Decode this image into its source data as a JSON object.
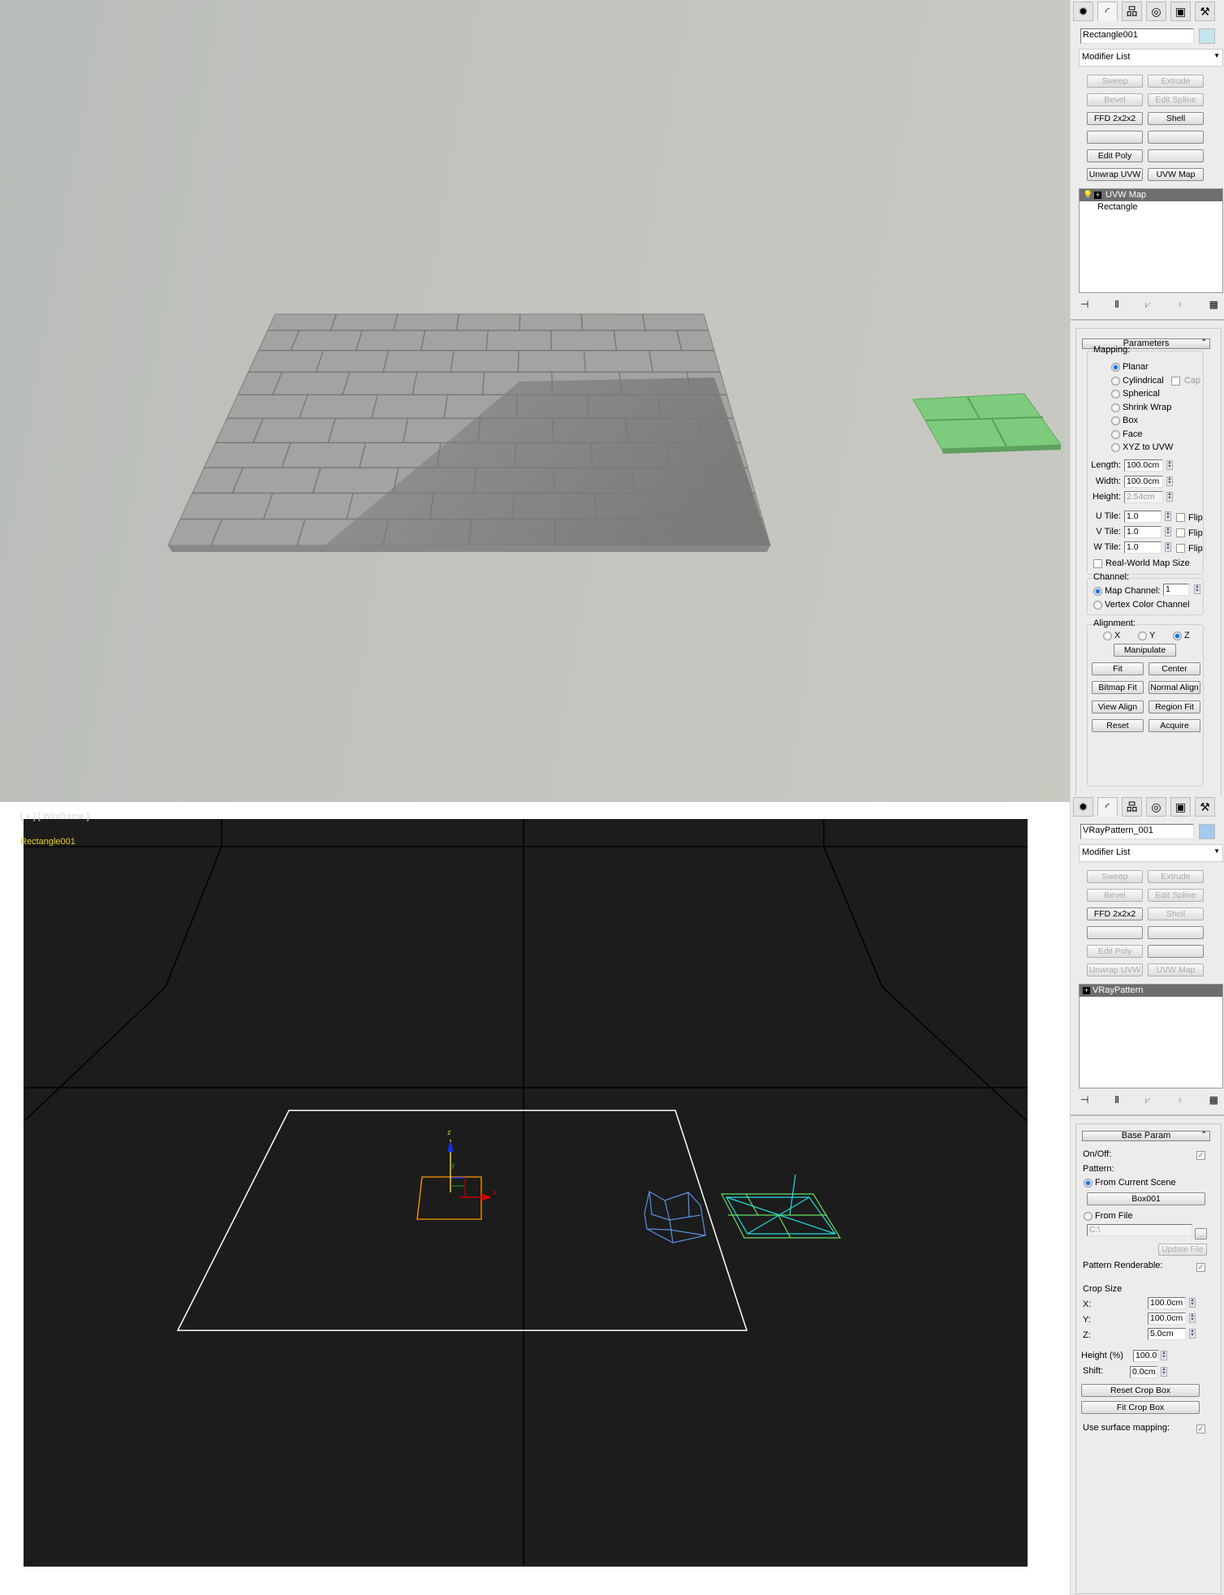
{
  "render_view": {
    "colors": {
      "background": "#c3c4bf",
      "tiles": "#9c9c9a",
      "pattern_tile": "#7ccc7c"
    }
  },
  "viewport": {
    "label": "[ + ] [ Wireframe ]",
    "object_name": "Rectangle001",
    "gizmo_labels": {
      "x": "x",
      "y": "y",
      "z": "z"
    },
    "colors": {
      "selection": "#ffffff",
      "uvw_gizmo": "#ff9900",
      "box": "#5b8fe0",
      "pattern": "#66dd66",
      "pattern_cyan": "#22dddd"
    }
  },
  "panel_top": {
    "tabs": [
      "create-icon",
      "modify-icon",
      "hierarchy-icon",
      "motion-icon",
      "display-icon",
      "utilities-icon"
    ],
    "object_name": "Rectangle001",
    "object_color": "#c4e6ee",
    "modifier_list": "Modifier List",
    "buttons": [
      {
        "label": "Sweep",
        "enabled": false
      },
      {
        "label": "Extrude",
        "enabled": false
      },
      {
        "label": "Bevel",
        "enabled": false
      },
      {
        "label": "Edit Spline",
        "enabled": false
      },
      {
        "label": "FFD 2x2x2",
        "enabled": true
      },
      {
        "label": "Shell",
        "enabled": true
      },
      {
        "label": "",
        "enabled": true
      },
      {
        "label": "",
        "enabled": true
      },
      {
        "label": "Edit Poly",
        "enabled": true
      },
      {
        "label": "",
        "enabled": true
      },
      {
        "label": "Unwrap UVW",
        "enabled": true
      },
      {
        "label": "UVW Map",
        "enabled": true
      }
    ],
    "stack": [
      "UVW Map",
      "Rectangle"
    ],
    "rollout": {
      "title": "Parameters",
      "mapping_label": "Mapping:",
      "mapping_options": [
        "Planar",
        "Cylindrical",
        "Spherical",
        "Shrink Wrap",
        "Box",
        "Face",
        "XYZ to UVW"
      ],
      "mapping_selected": "Planar",
      "cap_label": "Cap",
      "length_label": "Length:",
      "length": "100.0cm",
      "width_label": "Width:",
      "width": "100.0cm",
      "height_label": "Height:",
      "height": "2.54cm",
      "u_tile_label": "U Tile:",
      "u_tile": "1.0",
      "v_tile_label": "V Tile:",
      "v_tile": "1.0",
      "w_tile_label": "W Tile:",
      "w_tile": "1.0",
      "flip_label": "Flip",
      "real_world_label": "Real-World Map Size",
      "channel_label": "Channel:",
      "map_channel_label": "Map Channel:",
      "map_channel": "1",
      "vertex_color_label": "Vertex Color Channel",
      "alignment_label": "Alignment:",
      "axes": [
        "X",
        "Y",
        "Z"
      ],
      "axis_selected": "Z",
      "manipulate": "Manipulate",
      "action_buttons": [
        "Fit",
        "Center",
        "Bitmap Fit",
        "Normal Align",
        "View Align",
        "Region Fit",
        "Reset",
        "Acquire"
      ]
    }
  },
  "panel_bottom": {
    "object_name": "VRayPattern_001",
    "object_color": "#a6c8ee",
    "modifier_list": "Modifier List",
    "buttons": [
      {
        "label": "Sweep",
        "enabled": false
      },
      {
        "label": "Extrude",
        "enabled": false
      },
      {
        "label": "Bevel",
        "enabled": false
      },
      {
        "label": "Edit Spline",
        "enabled": false
      },
      {
        "label": "FFD 2x2x2",
        "enabled": true
      },
      {
        "label": "Shell",
        "enabled": false
      },
      {
        "label": "",
        "enabled": true
      },
      {
        "label": "",
        "enabled": true
      },
      {
        "label": "Edit Poly",
        "enabled": false
      },
      {
        "label": "",
        "enabled": true
      },
      {
        "label": "Unwrap UVW",
        "enabled": false
      },
      {
        "label": "UVW Map",
        "enabled": false
      }
    ],
    "stack": [
      "VRayPattern"
    ],
    "rollout": {
      "title": "Base Param",
      "on_off_label": "On/Off:",
      "on_off": true,
      "pattern_label": "Pattern:",
      "from_scene_label": "From Current Scene",
      "scene_object": "Box001",
      "from_file_label": "From File",
      "file_path": "C:\\",
      "browse": "...",
      "update_file": "Update File",
      "renderable_label": "Pattern Renderable:",
      "renderable": true,
      "crop_size_label": "Crop Size",
      "x_label": "X:",
      "x": "100.0cm",
      "y_label": "Y:",
      "y": "100.0cm",
      "z_label": "Z:",
      "z": "5.0cm",
      "height_pct_label": "Height (%)",
      "height_pct": "100.0",
      "shift_label": "Shift:",
      "shift": "0.0cm",
      "reset_crop": "Reset Crop Box",
      "fit_crop": "Fit Crop Box",
      "surface_mapping_label": "Use surface mapping:",
      "surface_mapping": true
    }
  }
}
